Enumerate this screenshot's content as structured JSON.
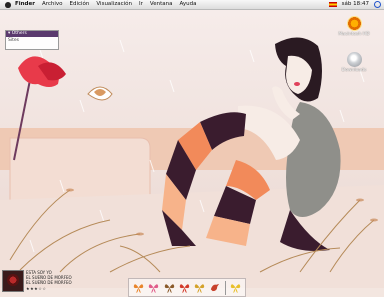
{
  "menubar": {
    "items": [
      "Finder",
      "Archivo",
      "Edición",
      "Visualización",
      "Ir",
      "Ventana",
      "Ayuda"
    ],
    "clock": "sáb 18:47"
  },
  "widget": {
    "header": "Others",
    "item": "Sites"
  },
  "desktop_icons": [
    {
      "label": "Macintosh HD",
      "icon": "hard-drive-icon"
    },
    {
      "label": "Downloads",
      "icon": "downloads-folder-icon"
    }
  ],
  "now_playing": {
    "line1": "ESTA SOY YO",
    "line2": "EL SUEÑO DE MORFEO",
    "line3": "EL SUEÑO DE MORFEO",
    "rating": "★★★☆☆"
  },
  "dock": {
    "items": [
      "butterfly-orange-icon",
      "butterfly-pink-icon",
      "butterfly-brown-icon",
      "butterfly-red-icon",
      "butterfly-gold-icon",
      "bird-icon",
      "butterfly-yellow-icon"
    ]
  }
}
